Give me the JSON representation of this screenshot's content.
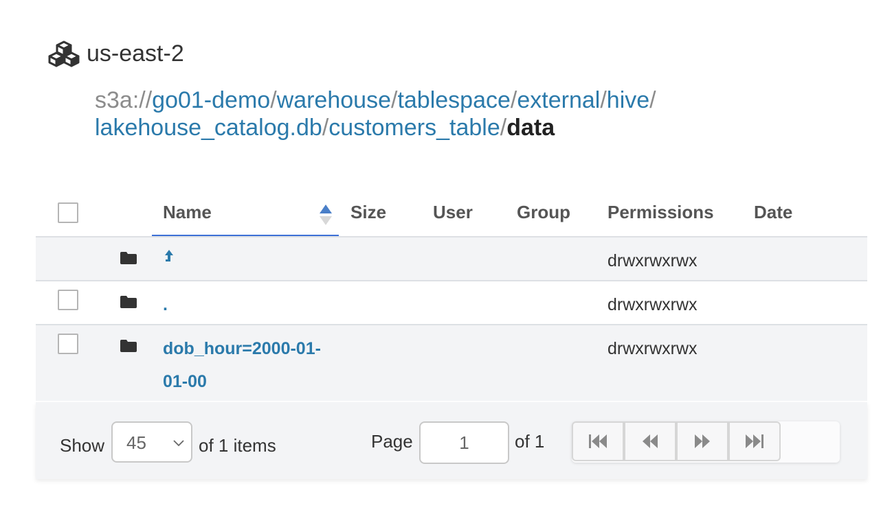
{
  "header": {
    "region_icon": "cubes-icon",
    "region_name": "us-east-2"
  },
  "path": {
    "scheme": "s3a://",
    "segments": [
      "go01-demo",
      "warehouse",
      "tablespace",
      "external",
      "hive",
      "lakehouse_catalog.db",
      "customers_table"
    ],
    "current": "data"
  },
  "table": {
    "columns": [
      "Name",
      "Size",
      "User",
      "Group",
      "Permissions",
      "Date"
    ],
    "sorted_column": "Name",
    "rows": [
      {
        "icon": "folder-icon",
        "name": "",
        "name_icon": "up-arrow-icon",
        "permissions": "drwxrwxrwx",
        "checkbox": false
      },
      {
        "icon": "folder-icon",
        "name": ".",
        "permissions": "drwxrwxrwx",
        "checkbox": true
      },
      {
        "icon": "folder-icon",
        "name": "dob_hour=2000-01-01-00",
        "permissions": "drwxrwxrwx",
        "checkbox": true
      }
    ]
  },
  "footer": {
    "show_label": "Show",
    "page_size": "45",
    "items_label": "of 1 items",
    "page_label": "Page",
    "page_value": "1",
    "page_total_label": "of 1",
    "pager_icons": [
      "first-page-icon",
      "previous-page-icon",
      "next-page-icon",
      "last-page-icon"
    ]
  },
  "colors": {
    "link": "#2b7aab",
    "sort_underline": "#3b6fd6",
    "row_alt": "#f3f4f6"
  }
}
